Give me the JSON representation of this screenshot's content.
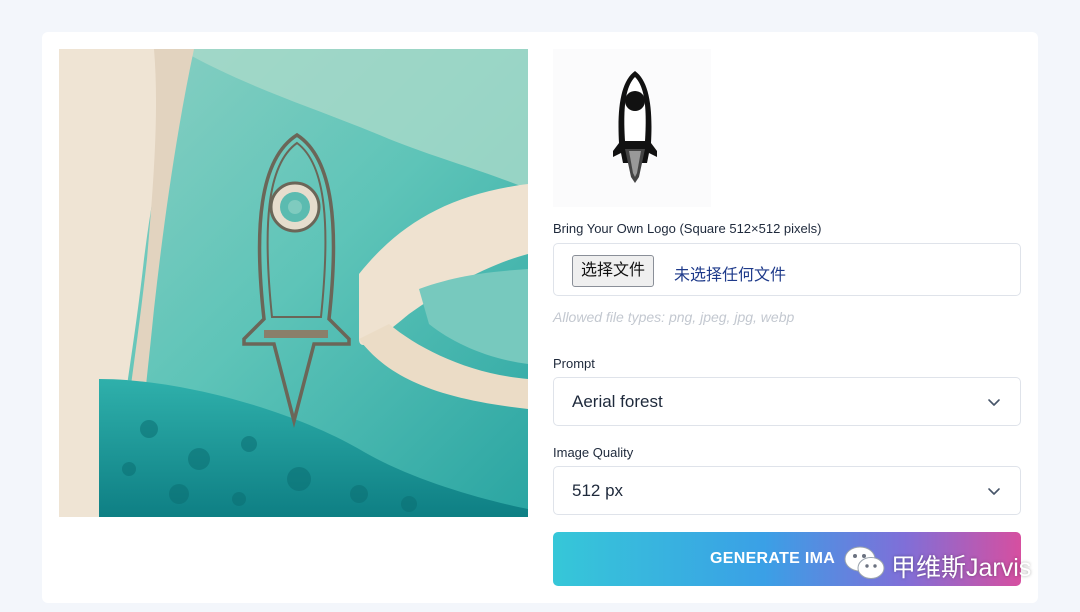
{
  "logo": {
    "label": "Bring Your Own Logo (Square 512×512 pixels)",
    "choose_button": "选择文件",
    "file_status": "未选择任何文件",
    "hint": "Allowed file types: png, jpeg, jpg, webp"
  },
  "prompt": {
    "label": "Prompt",
    "value": "Aerial forest"
  },
  "quality": {
    "label": "Image Quality",
    "value": "512 px"
  },
  "generate": {
    "label": "GENERATE IMA"
  },
  "watermark": {
    "text": "甲维斯Jarvis"
  },
  "colors": {
    "page_bg": "#f3f6fb",
    "text": "#1e293b",
    "button_gradient": [
      "#36c7d8",
      "#3aa0e6",
      "#7f6fd8",
      "#d64fa0"
    ]
  }
}
